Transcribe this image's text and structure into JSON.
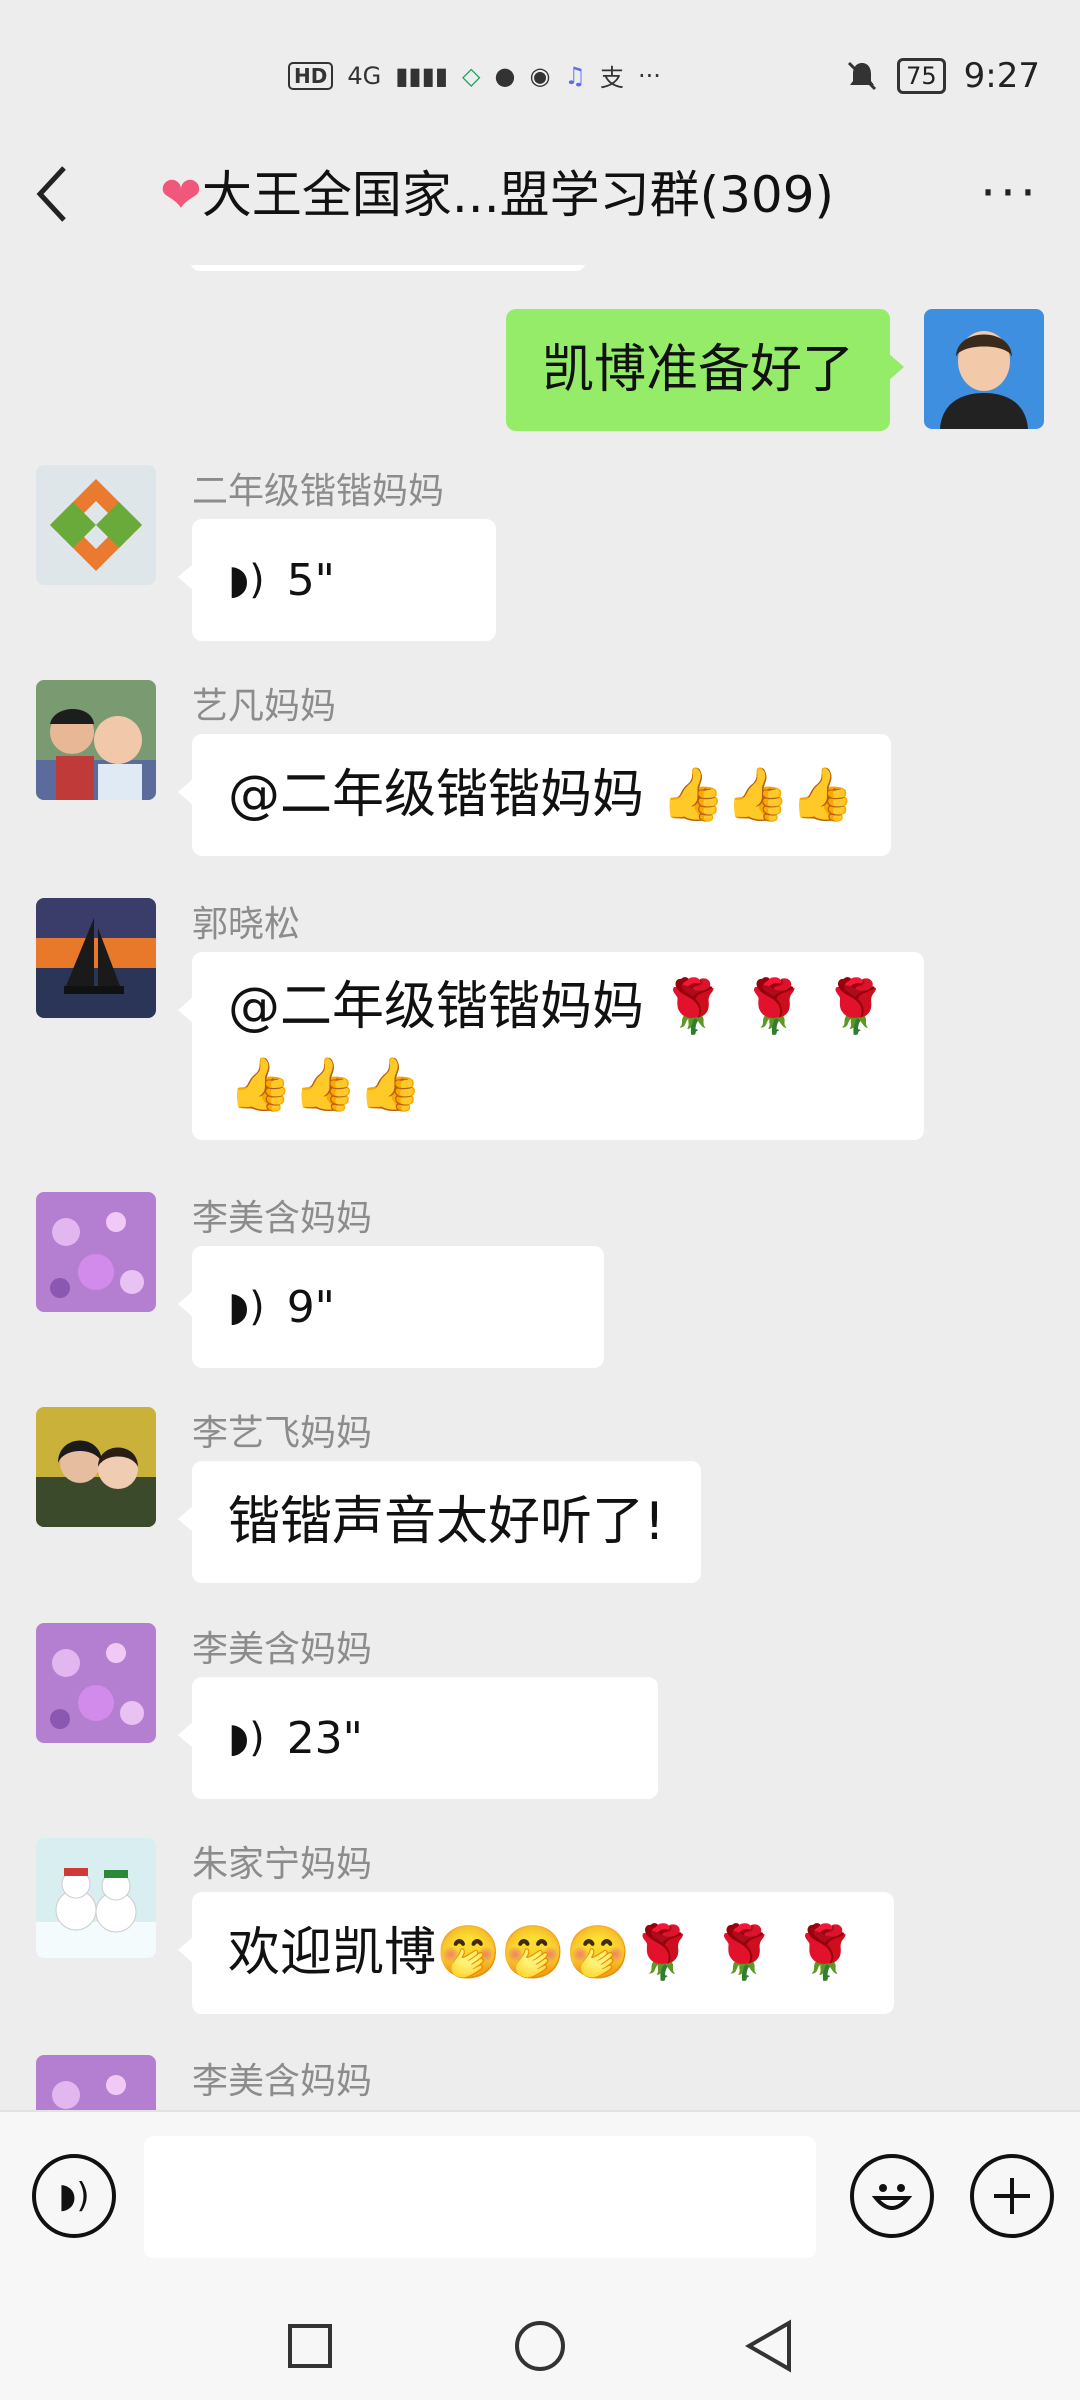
{
  "status_bar": {
    "left_items": [
      "HD",
      "4G",
      "▮▮▮▮",
      "◇",
      "●",
      "◉",
      "♫",
      "支",
      "···"
    ],
    "battery": "75",
    "time": "9:27"
  },
  "header": {
    "back_label": "‹",
    "heart": "❤",
    "title": "大王全国家...盟学习群(309)",
    "more_label": "···"
  },
  "messages": {
    "self": {
      "text": "凯博准备好了"
    },
    "m1": {
      "sender": "二年级锴锴妈妈",
      "duration": "5\""
    },
    "m2": {
      "sender": "艺凡妈妈",
      "text": "@二年级锴锴妈妈 👍👍👍"
    },
    "m3": {
      "sender": "郭晓松",
      "line1": "@二年级锴锴妈妈 🌹 🌹 🌹",
      "line2": "👍👍👍"
    },
    "m4": {
      "sender": "李美含妈妈",
      "duration": "9\""
    },
    "m5": {
      "sender": "李艺飞妈妈",
      "text": "锴锴声音太好听了!"
    },
    "m6": {
      "sender": "李美含妈妈",
      "duration": "23\""
    },
    "m7": {
      "sender": "朱家宁妈妈",
      "text": "欢迎凯博🤭🤭🤭🌹 🌹 🌹"
    },
    "m8": {
      "sender": "李美含妈妈"
    }
  },
  "input_bar": {
    "placeholder": ""
  },
  "colors": {
    "self_bubble": "#95ec69",
    "background": "#ededed",
    "bubble": "#ffffff"
  }
}
